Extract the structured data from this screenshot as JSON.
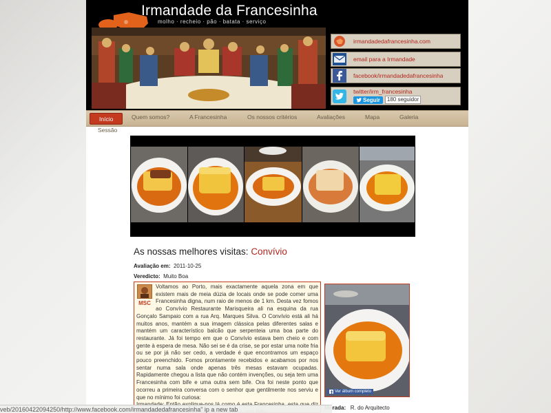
{
  "header": {
    "site_title": "Irmandade da Francesinha",
    "tagline": "molho · recheio · pão · batata · serviço"
  },
  "social": {
    "site_link": "irmandadedafrancesinha.com",
    "email_link": "email para a Irmandade",
    "facebook_link": "facebook/irmandadedafrancesinha",
    "twitter_link": "twitter/irm_francesinha",
    "follow_label": "Seguir",
    "follower_count": "180 seguidor"
  },
  "nav": {
    "items": [
      "Início",
      "Quem somos?",
      "A Francesinha",
      "Os nossos critérios",
      "Avaliações",
      "Mapa",
      "Galeria"
    ],
    "second_line": "Sessão"
  },
  "article": {
    "title_prefix": "As nossas melhores visitas: ",
    "title_place": "Convívio",
    "date_label": "Avaliação em:",
    "date_value": "2011-10-25",
    "verdict_label": "Veredicto:",
    "verdict_value": "Muito Boa",
    "author_initials": "MSC",
    "review_text": "Voltamos ao Porto, mais exactamente aquela zona em que existem mais de meia dúzia de locais onde se pode comer uma Francesinha digna, num raio de menos de 1 km. Desta vez fomos ao Convívio Restaurante Marisqueira ali na esquina da rua Gonçalo Sampaio com a rua Arq. Marques Silva. O Convívio está ali há muitos anos, mantém a sua imagem clássica pelas diferentes salas e mantém um característico balcão que serpenteia uma boa parte do restaurante. Já foi tempo em que o Convívio estava bem cheio e com gente à espera de mesa. Não sei se é da crise, se por estar uma noite fria ou se por já não ser cedo, a verdade é que encontramos um espaço pouco preenchido. Fomos prontamente recebidos e acabamos por nos sentar numa sala onde apenas três mesas estavam ocupadas. Rapidamente chegou a lista que não contém invenções, ou seja tem uma Francesinha com bife e uma outra sem bife. Ora foi neste ponto que ocorreu a primeira conversa com o senhor que gentilmente nos serviu e que no mínimo foi curiosa:",
    "review_dialog": "Irmandade: Então explique-nos lá como é esta Francesinha, esta que diz só Francesinha? (a outra dizia Francesinha com Bife)",
    "album_link": "Ver álbum completo",
    "address_label": "Morada:",
    "address_value": "R. do Arquitecto"
  },
  "status_bar": {
    "url": "veb/20160422094250/http://www.facebook.com/irmandadedafrancesinha\" ip a new tab"
  },
  "colors": {
    "accent_red": "#b3261e",
    "nav_active": "#c33a1f",
    "nav_bg": "#d9c8ad",
    "review_bg": "#fff9e6"
  }
}
